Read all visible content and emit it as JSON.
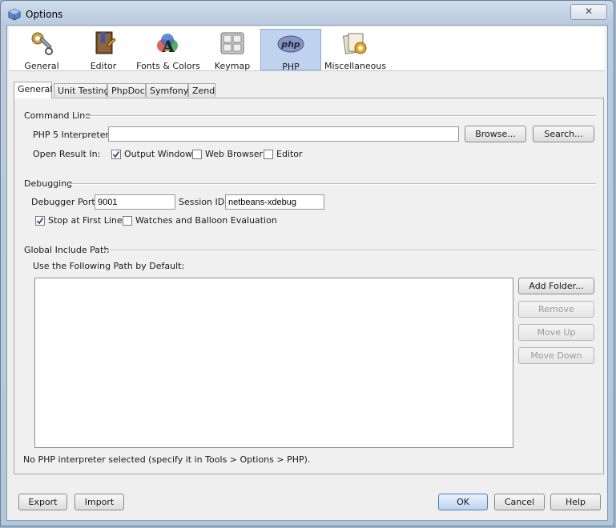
{
  "window": {
    "title": "Options",
    "close_glyph": "✕"
  },
  "categories": [
    {
      "label": "General",
      "icon": "general-tools-icon"
    },
    {
      "label": "Editor",
      "icon": "editor-book-icon"
    },
    {
      "label": "Fonts & Colors",
      "icon": "fonts-colors-icon"
    },
    {
      "label": "Keymap",
      "icon": "keymap-keyboard-icon"
    },
    {
      "label": "PHP",
      "icon": "php-logo-icon",
      "selected": true
    },
    {
      "label": "Miscellaneous",
      "icon": "miscellaneous-icon"
    }
  ],
  "tabs": [
    {
      "label": "General",
      "selected": true
    },
    {
      "label": "Unit Testing"
    },
    {
      "label": "PhpDoc"
    },
    {
      "label": "Symfony"
    },
    {
      "label": "Zend"
    }
  ],
  "command_line": {
    "title": "Command Line",
    "interpreter_label": "PHP 5 Interpreter:",
    "interpreter_value": "",
    "browse_label": "Browse...",
    "search_label": "Search...",
    "open_result_label": "Open Result In:",
    "output_window": {
      "label": "Output Window",
      "checked": true
    },
    "web_browser": {
      "label": "Web Browser",
      "checked": false
    },
    "editor": {
      "label": "Editor",
      "checked": false
    }
  },
  "debugging": {
    "title": "Debugging",
    "port_label": "Debugger Port:",
    "port_value": "9001",
    "session_label": "Session ID:",
    "session_value": "netbeans-xdebug",
    "stop_first_line": {
      "label": "Stop at First Line",
      "checked": true
    },
    "watches": {
      "label": "Watches and Balloon Evaluation",
      "checked": false
    }
  },
  "include_path": {
    "title": "Global Include Path",
    "subtitle": "Use the Following Path by Default:",
    "add_folder_label": "Add Folder...",
    "remove_label": "Remove",
    "move_up_label": "Move Up",
    "move_down_label": "Move Down"
  },
  "status_message": "No PHP interpreter selected (specify it in Tools > Options > PHP).",
  "footer": {
    "export_label": "Export",
    "import_label": "Import",
    "ok_label": "OK",
    "cancel_label": "Cancel",
    "help_label": "Help"
  },
  "colors": {
    "selected_category_bg": "#bfd3ef",
    "titlebar": "#b9cbe0",
    "check": "#1e3f8a"
  }
}
